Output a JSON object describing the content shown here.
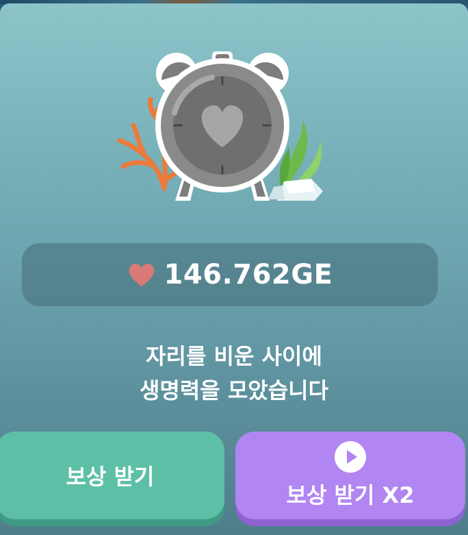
{
  "reward": {
    "amount": "146.762GE",
    "heart_color": "#d97a76"
  },
  "message": {
    "line1": "자리를 비운 사이에",
    "line2": "생명력을 모았습니다"
  },
  "buttons": {
    "claim_label": "보상 받기",
    "claim_x2_label": "보상 받기 X2",
    "claim_color": "#5dc0a6",
    "claim_x2_color": "#b185f2"
  },
  "icons": {
    "illustration": "alarm-clock-heart-icon",
    "amount": "heart-icon",
    "ad": "play-icon"
  }
}
